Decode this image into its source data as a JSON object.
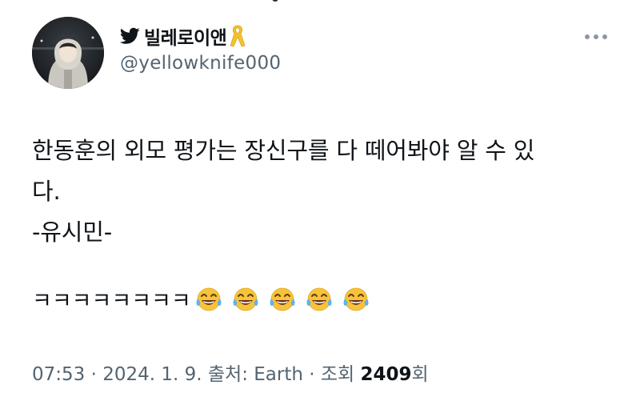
{
  "tweet": {
    "display_name": "빌레로이앤",
    "handle": "@yellowknife000",
    "more_icon": "more-dots-icon",
    "bird_icon": "twitter-bird-icon",
    "ribbon_icon": "yellow-ribbon-icon",
    "body_lines": [
      "한동훈의 외모 평가는 장신구를 다 떼어봐야 알 수 있",
      "다.",
      "-유시민-"
    ],
    "laugh_text": "ㅋㅋㅋㅋㅋㅋㅋㅋ",
    "emoji_name": "face-with-tears-of-joy",
    "emoji_count": 5,
    "meta_prefix": "07:53 · 2024. 1. 9. 출처: Earth · 조회 ",
    "views": "2409",
    "views_suffix": "회",
    "colors": {
      "text": "#0f1419",
      "secondary": "#536471",
      "bird": "#0f1419",
      "ribbon": "#f2c230",
      "emoji_face": "#f7c33a"
    }
  }
}
